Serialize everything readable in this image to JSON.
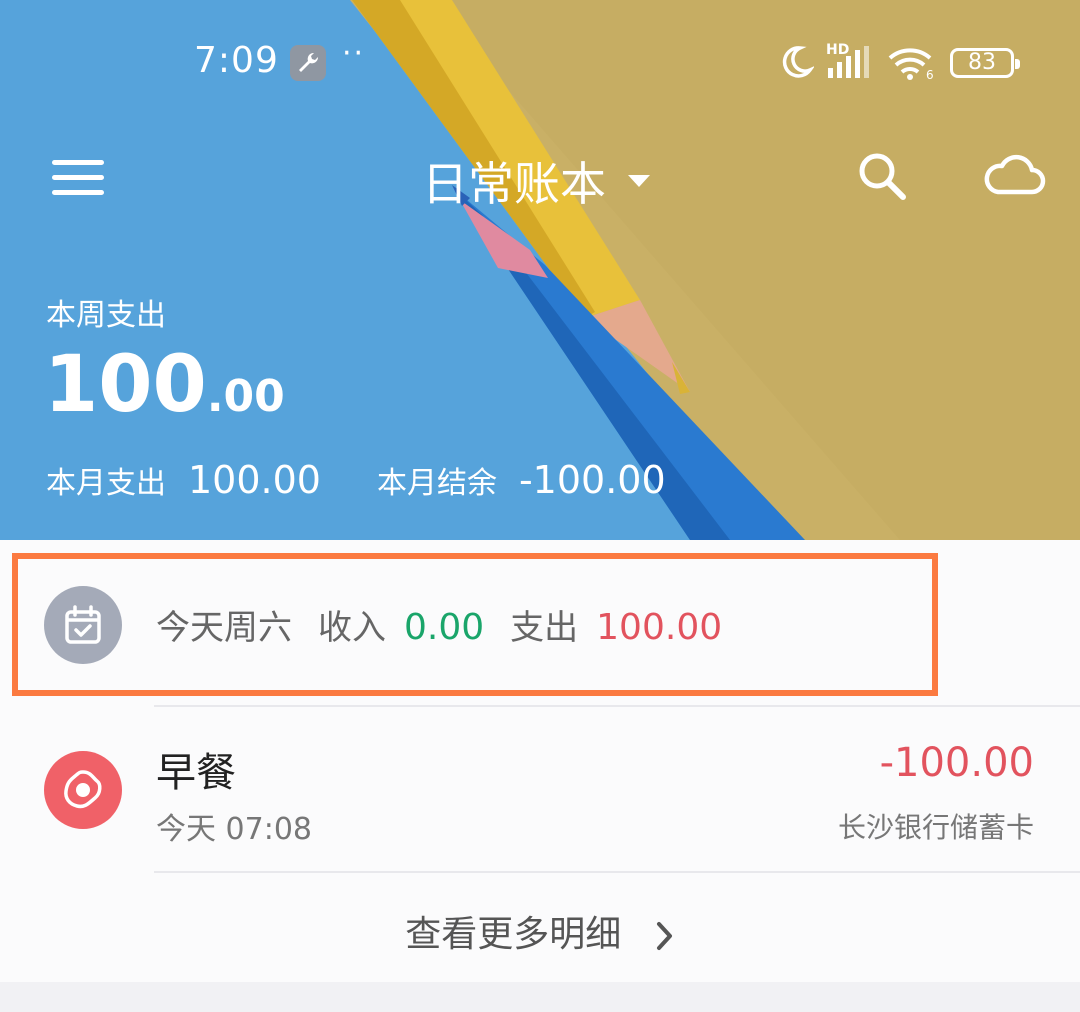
{
  "status_bar": {
    "time": "7:09",
    "dots": "··",
    "hd_label": "HD",
    "battery_level": "83",
    "icons": [
      "wrench-icon",
      "moon-icon",
      "signal-icon",
      "wifi-icon",
      "battery-icon"
    ]
  },
  "header": {
    "book_title": "日常账本",
    "icons": [
      "menu-icon",
      "dropdown-caret-icon",
      "search-icon",
      "cloud-icon"
    ]
  },
  "summary": {
    "week_label": "本周支出",
    "week_amount_int": "100",
    "week_amount_dec": ".00",
    "month_expense_label": "本月支出",
    "month_expense_value": "100.00",
    "month_balance_label": "本月结余",
    "month_balance_value": "-100.00"
  },
  "today": {
    "day_label": "今天周六",
    "income_label": "收入",
    "income_value": "0.00",
    "expense_label": "支出",
    "expense_value": "100.00",
    "highlight_color": "#fb7a40",
    "income_color": "#1aa56a",
    "expense_color": "#e2535e"
  },
  "transactions": [
    {
      "name": "早餐",
      "time": "今天 07:08",
      "amount": "-100.00",
      "account": "长沙银行储蓄卡",
      "icon": "fried-egg-icon",
      "icon_color": "#f06168"
    }
  ],
  "more_link": "查看更多明细"
}
